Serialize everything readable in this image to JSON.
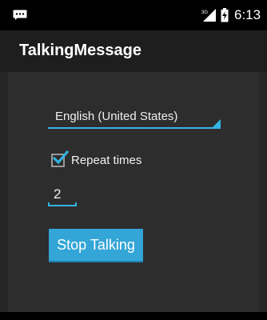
{
  "status_bar": {
    "time": "6:13",
    "signal_label": "3G",
    "notification_icon": "message-icon",
    "signal_icon": "cell-signal-icon",
    "battery_icon": "battery-charging-icon"
  },
  "action_bar": {
    "title": "TalkingMessage"
  },
  "form": {
    "language_selected": "English (United States)",
    "repeat_label": "Repeat times",
    "repeat_checked": true,
    "repeat_count": "2",
    "stop_button_label": "Stop Talking"
  },
  "colors": {
    "accent": "#33b5e5",
    "button": "#33a5d6",
    "background": "#2d2d2d",
    "action_bar": "#1e1e1e",
    "status_bar": "#000000"
  }
}
